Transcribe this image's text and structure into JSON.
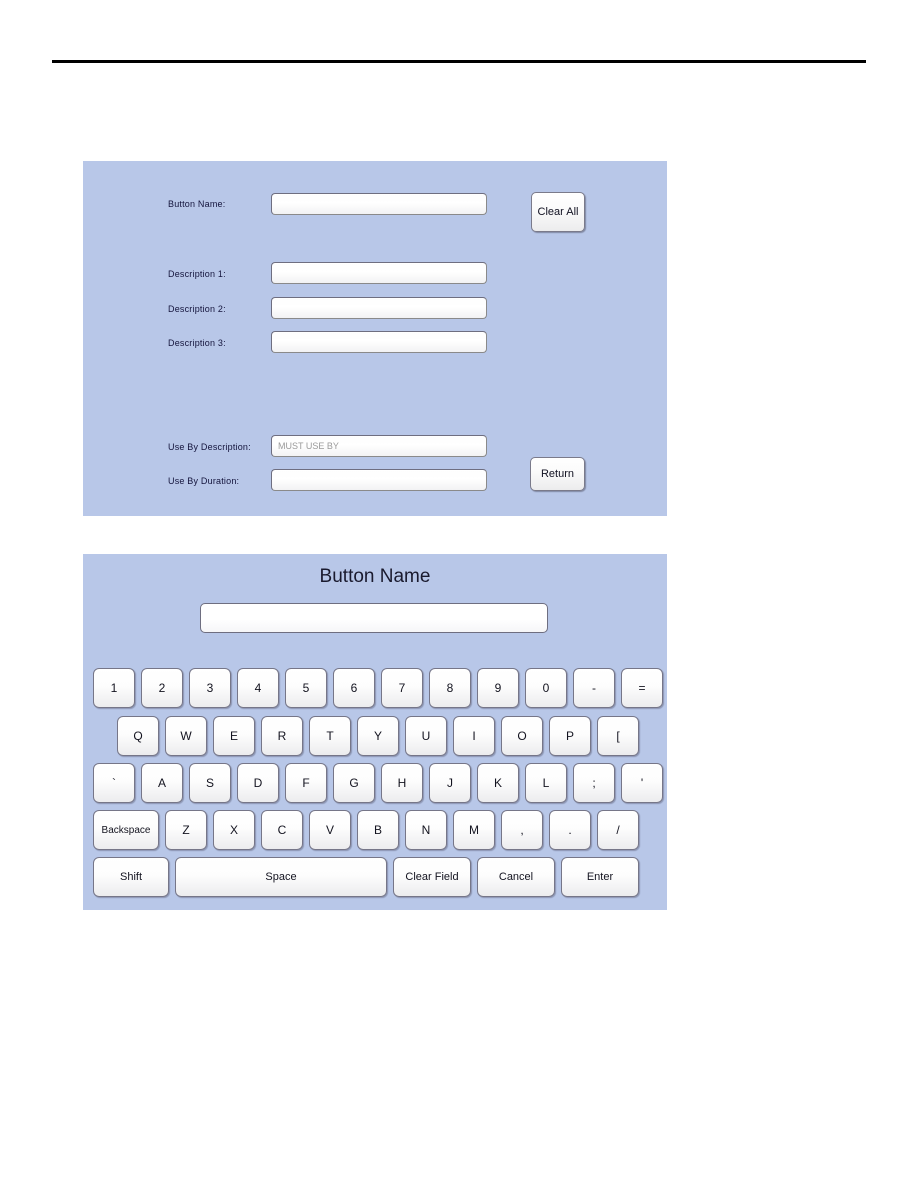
{
  "page": {
    "divider": "horizontal-rule"
  },
  "form": {
    "fields": [
      {
        "label": "Button Name:",
        "value": "",
        "placeholder": ""
      },
      {
        "label": "Description 1:",
        "value": "",
        "placeholder": ""
      },
      {
        "label": "Description 2:",
        "value": "",
        "placeholder": ""
      },
      {
        "label": "Description 3:",
        "value": "",
        "placeholder": ""
      },
      {
        "label": "Use By Description:",
        "value": "MUST USE BY",
        "placeholder": "MUST USE BY"
      },
      {
        "label": "Use By Duration:",
        "value": "",
        "placeholder": ""
      }
    ],
    "buttons": {
      "clear_all": "Clear All",
      "return": "Return"
    },
    "background_color": "#b8c7e8"
  },
  "keyboard": {
    "title": "Button Name",
    "input_value": "",
    "background_color": "#b8c7e8",
    "rows": [
      {
        "name": "number-row",
        "keys": [
          "1",
          "2",
          "3",
          "4",
          "5",
          "6",
          "7",
          "8",
          "9",
          "0",
          "-",
          "="
        ]
      },
      {
        "name": "top-letter-row",
        "keys": [
          "Q",
          "W",
          "E",
          "R",
          "T",
          "Y",
          "U",
          "I",
          "O",
          "P",
          "["
        ]
      },
      {
        "name": "home-row",
        "keys": [
          "`",
          "A",
          "S",
          "D",
          "F",
          "G",
          "H",
          "J",
          "K",
          "L",
          ";",
          "'"
        ]
      },
      {
        "name": "bottom-letter-row",
        "keys": [
          "Backspace",
          "Z",
          "X",
          "C",
          "V",
          "B",
          "N",
          "M",
          ",",
          ".",
          "/"
        ]
      },
      {
        "name": "function-row",
        "keys": [
          "Shift",
          "Space",
          "Clear Field",
          "Cancel",
          "Enter"
        ]
      }
    ]
  }
}
